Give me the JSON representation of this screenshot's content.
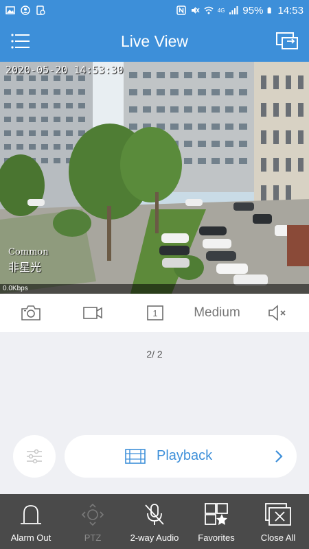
{
  "status_bar": {
    "battery": "95%",
    "time": "14:53",
    "network": "4G"
  },
  "app_bar": {
    "title": "Live View"
  },
  "video": {
    "timestamp": "2020-05-20 14:53:30",
    "channel_label_line1": "Common",
    "channel_label_line2": "非星光",
    "bitrate": "0.0Kbps"
  },
  "toolbar": {
    "window_count": "1",
    "quality": "Medium"
  },
  "pager": {
    "text": "2/ 2"
  },
  "playback": {
    "label": "Playback"
  },
  "bottom_bar": {
    "items": [
      {
        "label": "Alarm Out",
        "enabled": true
      },
      {
        "label": "PTZ",
        "enabled": false
      },
      {
        "label": "2-way Audio",
        "enabled": true
      },
      {
        "label": "Favorites",
        "enabled": true
      },
      {
        "label": "Close All",
        "enabled": true
      }
    ]
  },
  "colors": {
    "primary": "#3d8fd9",
    "bottom_bar": "#4a4a4a",
    "background": "#eff0f4"
  }
}
